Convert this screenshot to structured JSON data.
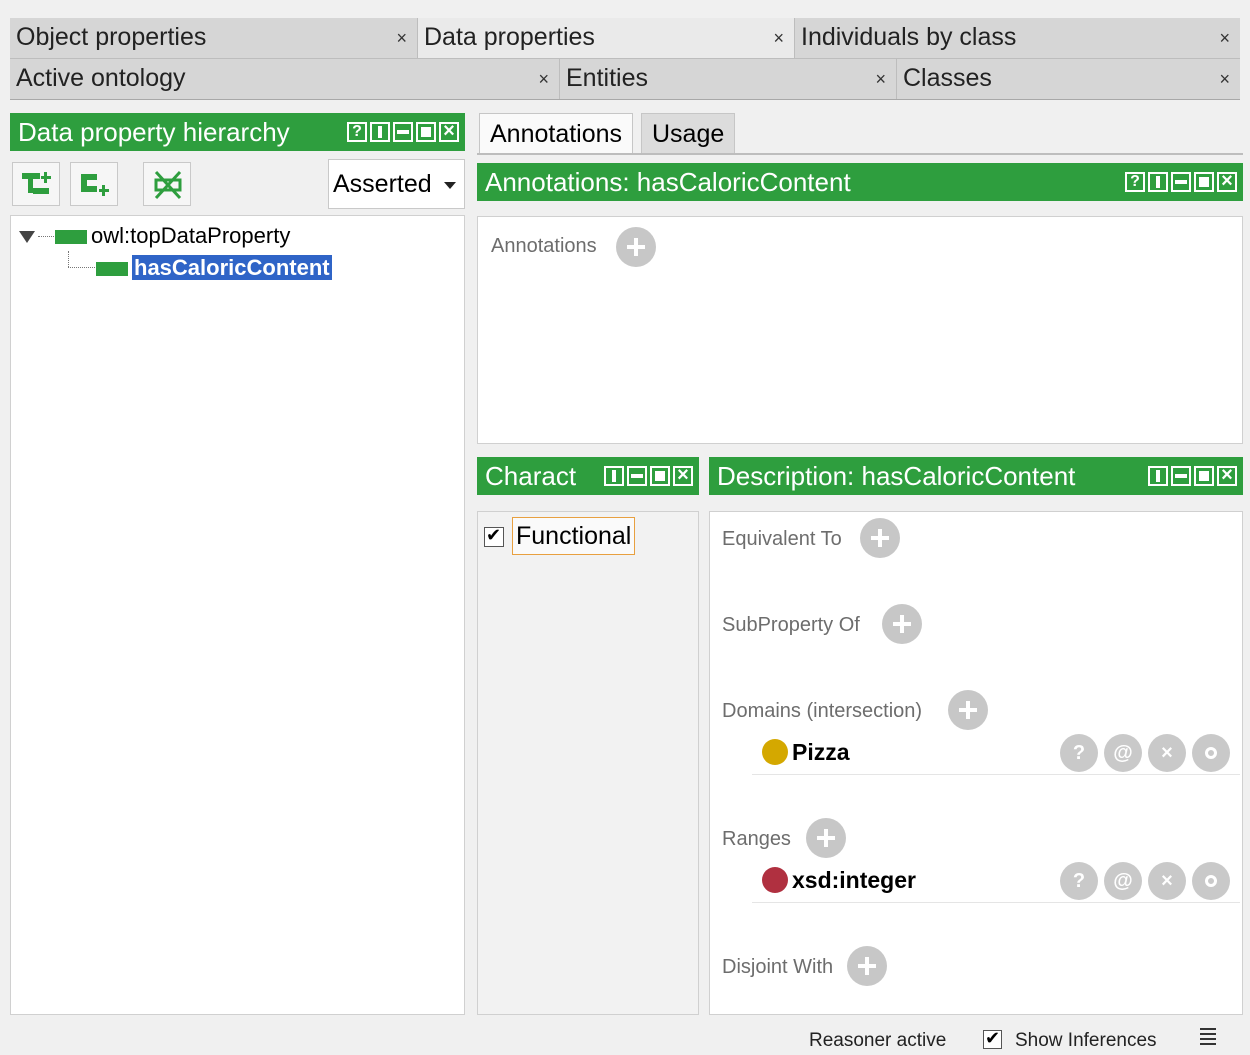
{
  "tabs_row1": [
    {
      "label": "Object properties",
      "selected": false
    },
    {
      "label": "Data properties",
      "selected": true
    },
    {
      "label": "Individuals by class",
      "selected": false
    }
  ],
  "tabs_row2": [
    {
      "label": "Active ontology",
      "selected": false
    },
    {
      "label": "Entities",
      "selected": false
    },
    {
      "label": "Classes",
      "selected": false
    }
  ],
  "close_glyph": "×",
  "left_panel": {
    "title": "Data property hierarchy",
    "toolbar": {
      "add_sub_property_icon": "add-sub-property-icon",
      "add_sibling_property_icon": "add-sibling-property-icon",
      "delete_property_icon": "delete-property-icon",
      "mode_select": "Asserted"
    },
    "tree": {
      "root": "owl:topDataProperty",
      "child": "hasCaloricContent",
      "selected": "hasCaloricContent"
    }
  },
  "right_panel": {
    "tabs": [
      {
        "label": "Annotations",
        "selected": true
      },
      {
        "label": "Usage",
        "selected": false
      }
    ],
    "annotations_header": "Annotations: hasCaloricContent",
    "annotations_label": "Annotations",
    "characteristics_header": "Charact",
    "functional_label": "Functional",
    "functional_checked": true,
    "description_header": "Description: hasCaloricContent",
    "sections": {
      "equivalent_to": "Equivalent To",
      "subproperty_of": "SubProperty Of",
      "domains": "Domains (intersection)",
      "ranges": "Ranges",
      "disjoint_with": "Disjoint With"
    },
    "domain_entry": {
      "name": "Pizza",
      "dot_color": "#d4a800"
    },
    "range_entry": {
      "name": "xsd:integer",
      "dot_color": "#b03040"
    },
    "entry_buttons": {
      "help": "?",
      "annotate": "@",
      "delete": "×"
    }
  },
  "status_bar": {
    "reasoner": "Reasoner active",
    "show_inferences_label": "Show Inferences",
    "show_inferences_checked": true
  },
  "colors": {
    "header_green": "#2e9e3e",
    "selection_blue": "#2f64c7",
    "focus_orange": "#e8a040"
  }
}
